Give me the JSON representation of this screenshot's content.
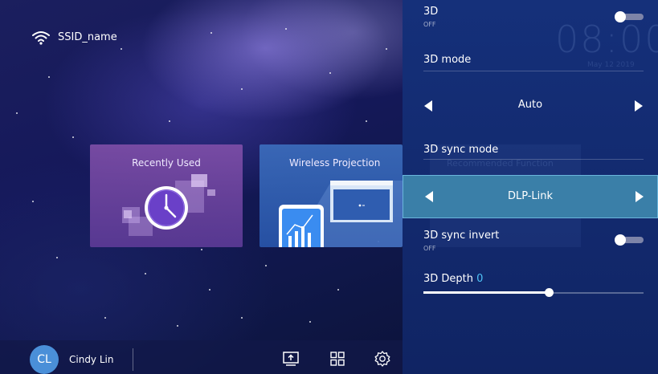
{
  "status": {
    "ssid": "SSID_name",
    "wifi_icon": "wifi-icon"
  },
  "tiles": [
    {
      "label": "Recently Used",
      "icon": "clock-icon",
      "color": "#7b4ea6"
    },
    {
      "label": "Wireless Projection",
      "icon": "phone-to-screen-icon",
      "color": "#3a6bb8"
    }
  ],
  "bottom_bar": {
    "avatar_initials": "CL",
    "user_name": "Cindy Lin",
    "icons": [
      "screen-share-icon",
      "apps-grid-icon",
      "settings-gear-icon"
    ]
  },
  "background_widgets": {
    "clock": "08:00",
    "date": "May 12 2019",
    "recommended": "Recommended Function"
  },
  "panel": {
    "three_d": {
      "title": "3D",
      "state": "OFF",
      "on": false
    },
    "three_d_mode": {
      "title": "3D mode",
      "value": "Auto"
    },
    "sync_mode": {
      "title": "3D sync mode",
      "value": "DLP-Link"
    },
    "sync_invert": {
      "title": "3D sync invert",
      "state": "OFF",
      "on": false
    },
    "depth": {
      "title": "3D Depth",
      "value": "0",
      "level": 0.57
    }
  },
  "colors": {
    "panel_bg": "#15307a",
    "active_row": "#3a7fa8",
    "accent": "#4fc3f7"
  }
}
